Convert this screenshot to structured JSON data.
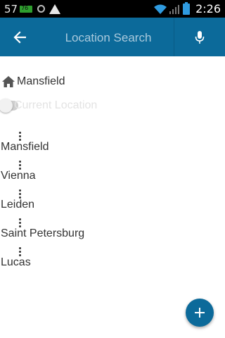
{
  "status_bar": {
    "left_number": "57",
    "battery_small_text": "76",
    "time": "2:26",
    "icons": [
      "notification-battery-icon",
      "sync-icon",
      "warning-icon",
      "wifi-icon",
      "signal-icon",
      "battery-icon"
    ]
  },
  "app_bar": {
    "search_placeholder": "Location Search",
    "color": "#0c6a9a",
    "back_icon": "arrow-left-icon",
    "mic_icon": "microphone-icon"
  },
  "home": {
    "label": "Mansfield",
    "icon": "home-icon"
  },
  "current_location": {
    "label": "Current Location",
    "enabled": false
  },
  "locations": [
    {
      "name": "Mansfield"
    },
    {
      "name": "Vienna"
    },
    {
      "name": "Leiden"
    },
    {
      "name": "Saint Petersburg"
    },
    {
      "name": "Lucas"
    }
  ],
  "fab": {
    "icon": "plus-icon",
    "color": "#0c6a9a"
  }
}
